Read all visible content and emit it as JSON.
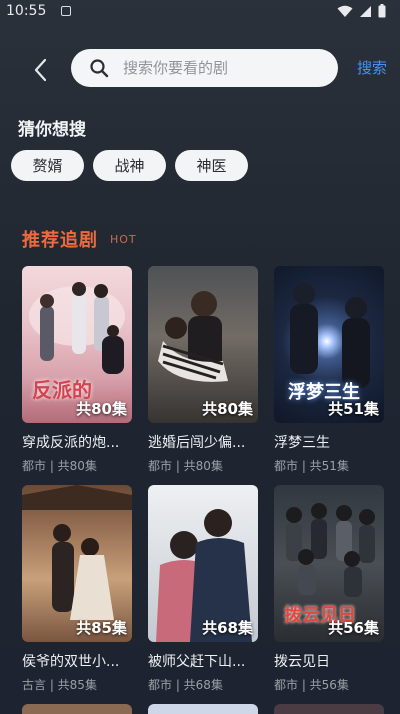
{
  "status_bar": {
    "time": "10:55"
  },
  "header": {
    "back_icon": "chevron-left-icon",
    "search_placeholder": "搜索你要看的剧",
    "search_button": "搜索"
  },
  "guess": {
    "title": "猜你想搜",
    "chips": [
      "赘婿",
      "战神",
      "神医"
    ]
  },
  "recommend": {
    "title": "推荐追剧",
    "badge": "HOT",
    "dramas": [
      {
        "title": "穿成反派的炮...",
        "genre": "都市",
        "count": "共80集",
        "meta": "都市 | 共80集",
        "poster_text": "反派的"
      },
      {
        "title": "逃婚后闯少偏...",
        "genre": "都市",
        "count": "共80集",
        "meta": "都市 | 共80集",
        "poster_text": ""
      },
      {
        "title": "浮梦三生",
        "genre": "都市",
        "count": "共51集",
        "meta": "都市 | 共51集",
        "poster_text": "浮梦三生"
      },
      {
        "title": "侯爷的双世小...",
        "genre": "古言",
        "count": "共85集",
        "meta": "古言 | 共85集",
        "poster_text": ""
      },
      {
        "title": "被师父赶下山...",
        "genre": "都市",
        "count": "共68集",
        "meta": "都市 | 共68集",
        "poster_text": ""
      },
      {
        "title": "拨云见日",
        "genre": "都市",
        "count": "共56集",
        "meta": "都市 | 共56集",
        "poster_text": "拨云见日"
      }
    ]
  },
  "colors": {
    "accent_blue": "#4b8ff0",
    "section_orange": "#ee6a3c",
    "background": "#222933"
  }
}
